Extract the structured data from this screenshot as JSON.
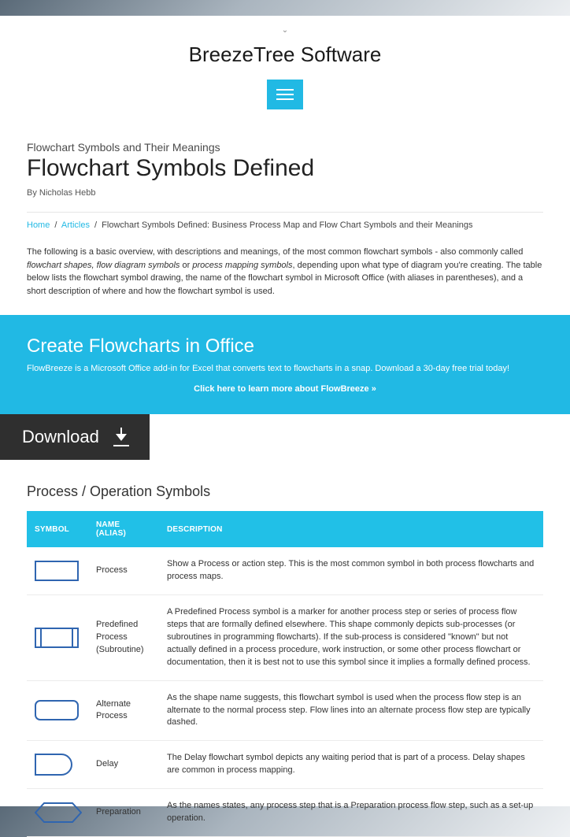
{
  "brand": "BreezeTree Software",
  "article": {
    "kicker": "Flowchart Symbols and Their Meanings",
    "title": "Flowchart Symbols Defined",
    "byline": "By Nicholas Hebb"
  },
  "breadcrumb": {
    "home": "Home",
    "articles": "Articles",
    "current": "Flowchart Symbols Defined: Business Process Map and Flow Chart Symbols and their Meanings"
  },
  "intro": {
    "pre": "The following is a basic overview, with descriptions and meanings, of the most common flowchart symbols - also commonly called ",
    "em1": "flowchart shapes, flow diagram symbols",
    "mid": " or ",
    "em2": "process mapping symbols",
    "post": ", depending upon what type of diagram you're creating. The table below lists the flowchart symbol drawing, the name of the flowchart symbol in Microsoft Office (with aliases in parentheses), and a short description of where and how the flowchart symbol is used."
  },
  "promo": {
    "title": "Create Flowcharts in Office",
    "sub": "FlowBreeze is a Microsoft Office add-in for Excel that converts text to flowcharts in a snap. Download a 30-day free trial today!",
    "link": "Click here to learn more about FlowBreeze »"
  },
  "download_label": "Download",
  "section_title": "Process / Operation Symbols",
  "table": {
    "headers": {
      "symbol": "SYMBOL",
      "name": "NAME (ALIAS)",
      "description": "DESCRIPTION"
    },
    "rows": [
      {
        "name": "Process",
        "desc": "Show a Process or action step. This is the most common symbol in both process flowcharts and process maps."
      },
      {
        "name": "Predefined Process (Subroutine)",
        "desc": "A Predefined Process symbol is a marker for another process step or series of process flow steps that are formally defined elsewhere. This shape commonly depicts sub-processes (or subroutines in programming flowcharts). If the sub-process is considered \"known\" but not actually defined in a process procedure, work instruction, or some other process flowchart or documentation, then it is best not to use this symbol since it implies a formally defined process."
      },
      {
        "name": "Alternate Process",
        "desc": "As the shape name suggests, this flowchart symbol is used when the process flow step is an alternate to the normal process step. Flow lines into an alternate process flow step are typically dashed."
      },
      {
        "name": "Delay",
        "desc": "The Delay flowchart symbol depicts any waiting period that is part of a process. Delay shapes are common in process mapping."
      },
      {
        "name": "Preparation",
        "desc": "As the names states, any process step that is a Preparation process flow step, such as a set-up operation."
      }
    ]
  }
}
